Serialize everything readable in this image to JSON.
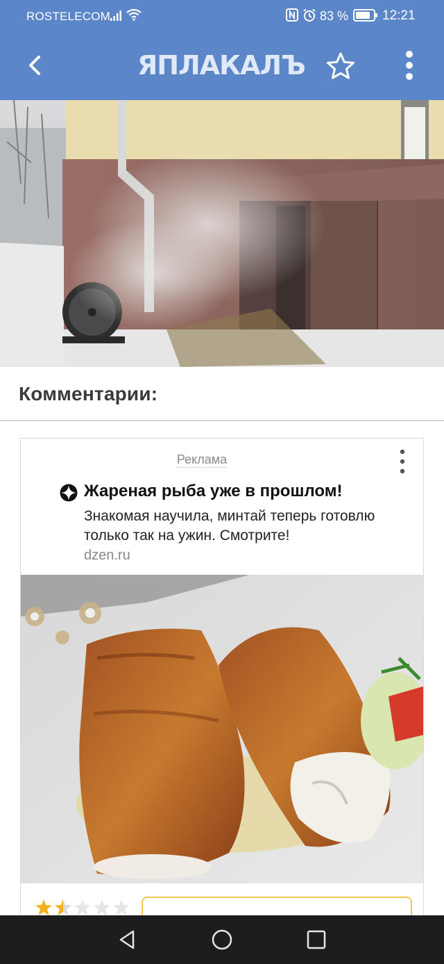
{
  "status_bar": {
    "carrier": "ROSTELECOM",
    "battery_percent": "83 %",
    "time": "12:21",
    "icons": [
      "signal-icon",
      "wifi-icon",
      "nfc-icon",
      "alarm-icon",
      "battery-icon"
    ]
  },
  "app_bar": {
    "logo": "ЯПЛАКАЛЪ",
    "icons": [
      "back-arrow-icon",
      "star-icon",
      "more-vertical-icon"
    ]
  },
  "comments": {
    "title": "Комментарии:"
  },
  "ad": {
    "label": "Реклама",
    "title": "Жареная рыба уже в прошлом!",
    "description": "Знакомая научила, минтай теперь готовлю только так на ужин. Смотрите!",
    "domain": "dzen.ru",
    "rating_stars": 1.5,
    "rating_max": 5
  },
  "nav_bar": {
    "icons": [
      "nav-back-icon",
      "nav-home-icon",
      "nav-recents-icon"
    ]
  },
  "colors": {
    "accent": "#5b87c9",
    "star_filled": "#f2b01e",
    "star_empty": "#d9d9d9",
    "cta_border": "#f2c94c"
  }
}
